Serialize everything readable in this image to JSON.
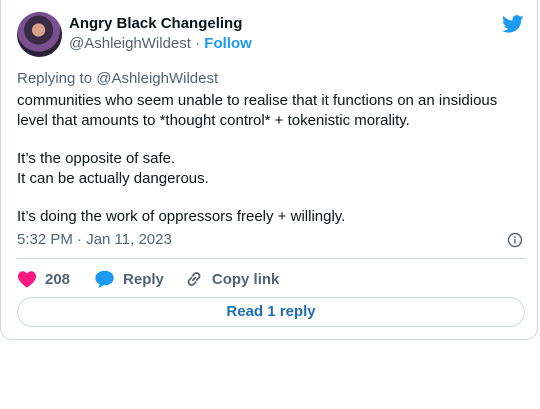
{
  "author": {
    "name": "Angry Black Changeling",
    "handle": "@AshleighWildest",
    "separator": "·",
    "follow_label": "Follow"
  },
  "tweet": {
    "replying_to": "Replying to @AshleighWildest",
    "paragraphs": [
      "communities who seem unable to realise that it functions on an insidious level that amounts to *thought control* + tokenistic morality.",
      "It’s the opposite of safe.",
      "It can be actually dangerous.",
      "It’s doing the work of oppressors freely + willingly."
    ],
    "timestamp": "5:32 PM · Jan 11, 2023"
  },
  "actions": {
    "like_count": "208",
    "reply_label": "Reply",
    "copy_link_label": "Copy link"
  },
  "read_replies_label": "Read 1 reply",
  "colors": {
    "brand_blue": "#1d9bf0",
    "heart_pink": "#f91880",
    "muted_text": "#536471",
    "border": "#cfd9de"
  },
  "icons": [
    "twitter-bird-icon",
    "heart-icon",
    "reply-bubble-icon",
    "link-icon",
    "info-icon"
  ]
}
